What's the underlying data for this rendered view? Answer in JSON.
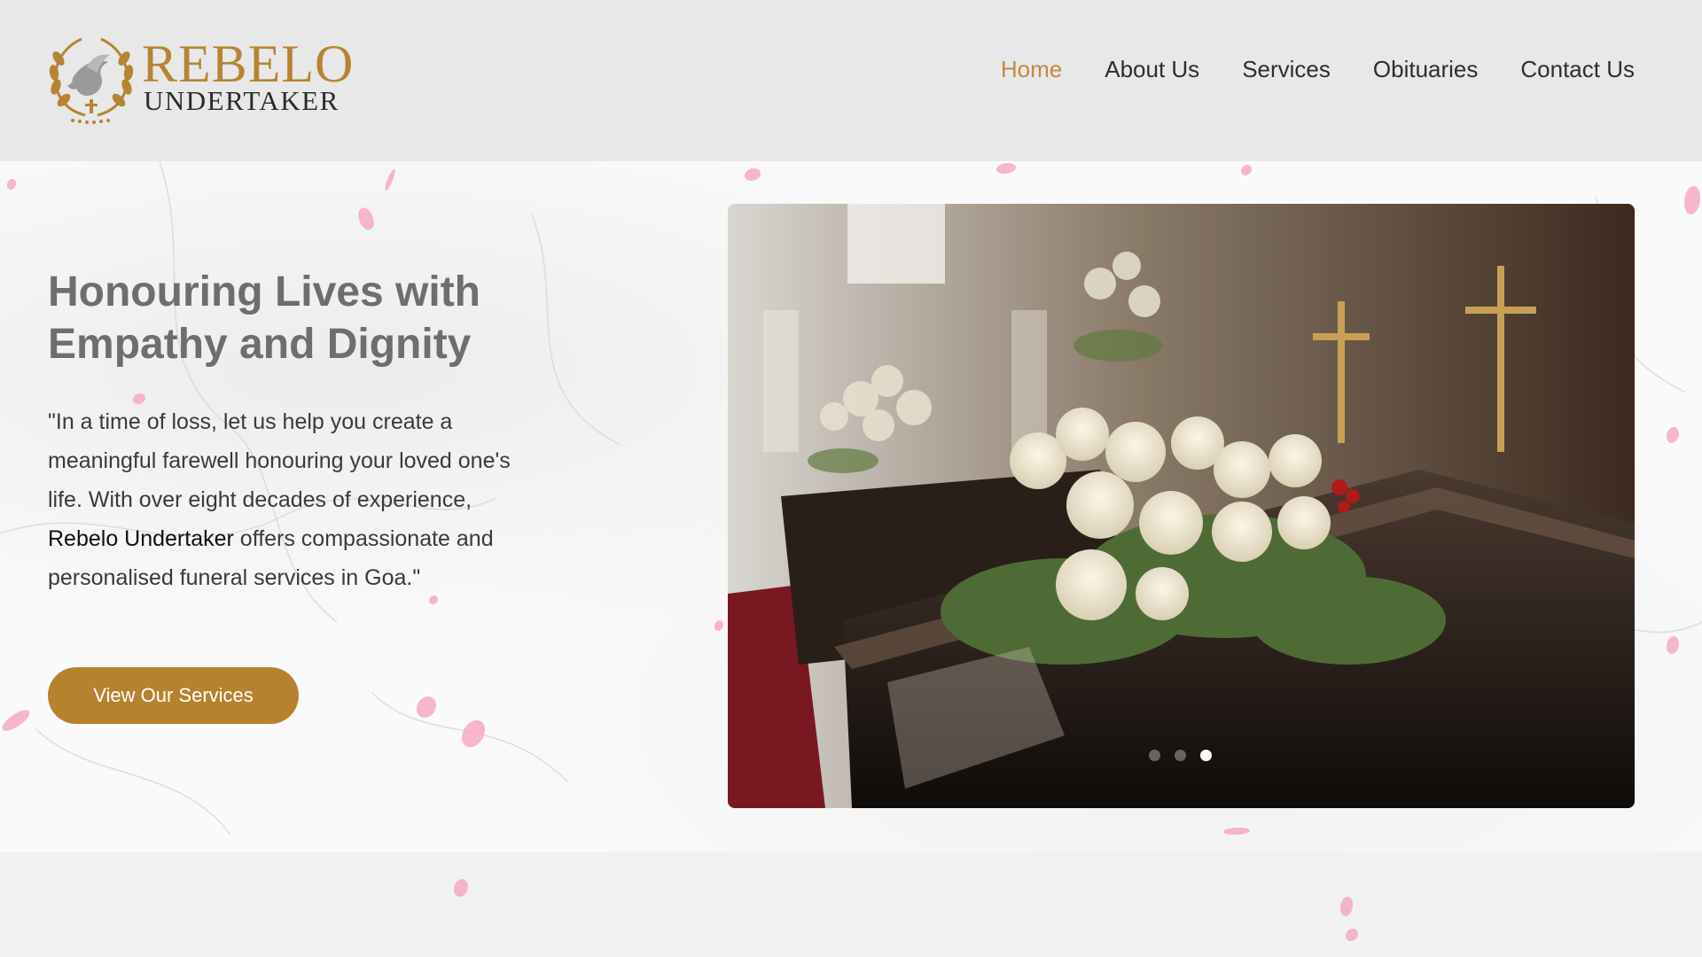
{
  "brand": {
    "title": "REBELO",
    "subtitle": "UNDERTAKER"
  },
  "nav": {
    "items": [
      {
        "label": "Home",
        "active": true
      },
      {
        "label": "About Us"
      },
      {
        "label": "Services"
      },
      {
        "label": "Obituaries"
      },
      {
        "label": "Contact Us"
      }
    ]
  },
  "hero": {
    "heading": "Honouring Lives with Empathy and Dignity",
    "quote_start": "\"In a time of loss, let us help you create a meaningful farewell honouring your loved one's life. With over eight decades of experience, ",
    "quote_brand": "Rebelo Undertaker",
    "quote_end": " offers compassionate and personalised funeral services in Goa.\"",
    "cta_label": "View Our Services"
  },
  "slider": {
    "slide_count": 3,
    "active_index": 2
  },
  "colors": {
    "accent": "#b5822f",
    "nav_active": "#c08a40",
    "header_bg": "#e8e8e8",
    "petal": "#f4a9c3"
  },
  "icons": {
    "logo": "dove-laurel-emblem-icon"
  }
}
